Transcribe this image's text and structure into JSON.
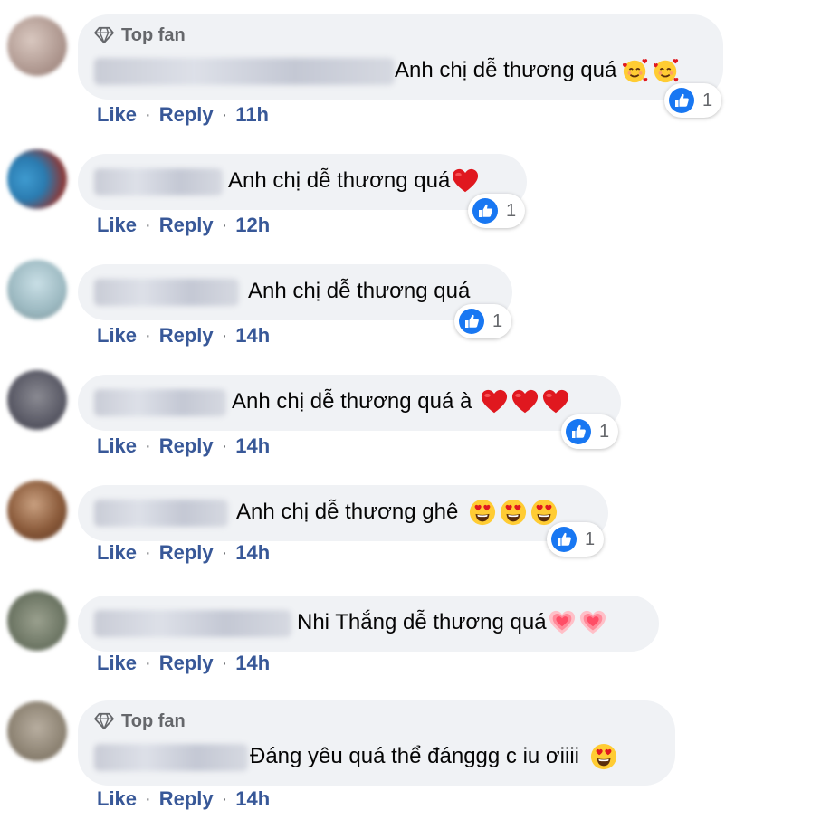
{
  "colors": {
    "link": "#385898",
    "bubble": "#f0f2f5",
    "like_blue": "#1877f2",
    "heart_red": "#e0181f"
  },
  "comments": [
    {
      "top_fan": "Top fan",
      "text": "Anh chị dễ thương quá",
      "emojis": [
        "smiling-face-with-hearts-icon",
        "smiling-face-with-hearts-icon"
      ],
      "reactions": "1",
      "like": "Like",
      "reply": "Reply",
      "dot": "·",
      "time": "11h"
    },
    {
      "text": "Anh chị dễ thương quá",
      "emojis": [
        "red-heart-icon"
      ],
      "reactions": "1",
      "like": "Like",
      "reply": "Reply",
      "dot": "·",
      "time": "12h"
    },
    {
      "text": "Anh chị dễ thương quá",
      "emojis": [],
      "reactions": "1",
      "like": "Like",
      "reply": "Reply",
      "dot": "·",
      "time": "14h"
    },
    {
      "text": "Anh chị dễ thương quá à",
      "emojis": [
        "red-heart-icon",
        "red-heart-icon",
        "red-heart-icon"
      ],
      "reactions": "1",
      "like": "Like",
      "reply": "Reply",
      "dot": "·",
      "time": "14h"
    },
    {
      "text": "Anh chị dễ thương ghê",
      "emojis": [
        "heart-eyes-icon",
        "heart-eyes-icon",
        "heart-eyes-icon"
      ],
      "reactions": "1",
      "like": "Like",
      "reply": "Reply",
      "dot": "·",
      "time": "14h"
    },
    {
      "text": "Nhi Thắng dễ thương quá",
      "emojis": [
        "growing-heart-icon",
        "growing-heart-icon"
      ],
      "like": "Like",
      "reply": "Reply",
      "dot": "·",
      "time": "14h"
    },
    {
      "top_fan": "Top fan",
      "text": "Đáng yêu quá thể đánggg c iu ơiiii",
      "emojis": [
        "heart-eyes-icon"
      ],
      "like": "Like",
      "reply": "Reply",
      "dot": "·",
      "time": "14h"
    }
  ]
}
